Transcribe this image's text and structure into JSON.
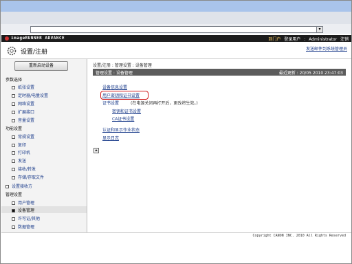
{
  "app": {
    "brand": "imageRUNNER ADVANCE",
    "portal_link": "到门户",
    "login_user_label": "登录用户",
    "login_user": "Administrator",
    "logout_link": "注销"
  },
  "page_header": {
    "title": "设置/注册",
    "send_mail_link": "发送邮件到系统管理员"
  },
  "sidebar": {
    "restart_button": "重新启动设备",
    "sections": [
      {
        "title": "参数选择",
        "items": [
          "纸张设置",
          "定时器/电量设置",
          "网络设置",
          "扩展接口",
          "音量设置"
        ]
      },
      {
        "title": "功能设置",
        "items": [
          "常规设置",
          "复印",
          "打印机",
          "发送",
          "接收/转发",
          "存储/存取文件"
        ]
      },
      {
        "top_item": "设置接收方"
      },
      {
        "title": "管理设置",
        "items": [
          "用户管理",
          "设备管理",
          "许可证/其他",
          "数据管理"
        ]
      }
    ]
  },
  "main": {
    "breadcrumb": "设置/注册 : 管理设置 : 设备管理",
    "section_title": "管理设置 : 设备管理",
    "last_update_label": "最近更新",
    "last_update_value": "20/05 2010 23:47:03",
    "links": {
      "device_info": "设备信息设置",
      "user_signature": "用户密钥和证书设置",
      "certificate": "证书设置",
      "certificate_note": "(在电源关闭再打开后，更改将生效。)",
      "key_and_cert": "密钥和证书设置",
      "ca_cert": "CA证书设置",
      "auth_mgmt": "认证和显示作业状态",
      "display_log": "显示日志"
    }
  },
  "footer": {
    "copyright": "Copyright CANON INC. 2010 All Rights Reserved"
  },
  "colors": {
    "titlebar": "#a9c4eb",
    "appbar": "#1c1c1c",
    "section_bar": "#5c5c5c",
    "link": "#1a3b8a",
    "highlight": "#d01818"
  }
}
